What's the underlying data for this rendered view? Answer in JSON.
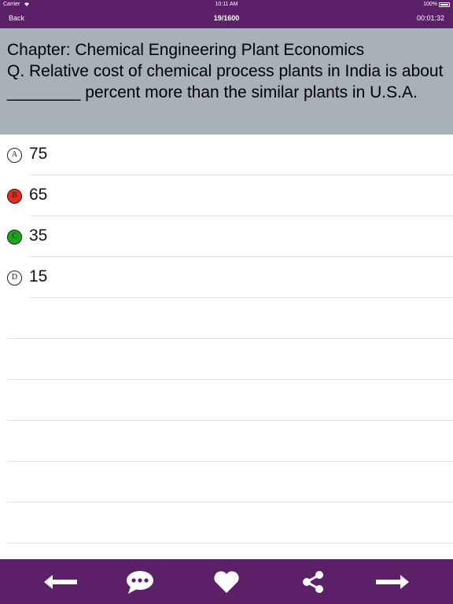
{
  "status": {
    "carrier": "Carrier",
    "time": "10:11 AM",
    "battery": "100%",
    "wifi_icon": "wifi-icon",
    "battery_icon": "battery-icon"
  },
  "nav": {
    "back_label": "Back",
    "counter": "19/1600",
    "timer": "00:01:32"
  },
  "question": {
    "chapter_line": "Chapter: Chemical Engineering Plant Economics",
    "text": "Q. Relative cost of chemical process plants in India is about ________ percent more than the similar plants in U.S.A."
  },
  "options": [
    {
      "letter": "A",
      "text": "75",
      "state": "default",
      "color": "#ffffff"
    },
    {
      "letter": "B",
      "text": "65",
      "state": "wrong",
      "color": "#e8291c"
    },
    {
      "letter": "C",
      "text": "35",
      "state": "correct",
      "color": "#1aa51a"
    },
    {
      "letter": "D",
      "text": "15",
      "state": "default",
      "color": "#ffffff"
    }
  ],
  "toolbar": {
    "items": [
      "arrow-left-icon",
      "comment-icon",
      "heart-icon",
      "share-icon",
      "arrow-right-icon"
    ]
  },
  "colors": {
    "primary": "#5b2068",
    "question_bg": "#a8b0b8"
  }
}
